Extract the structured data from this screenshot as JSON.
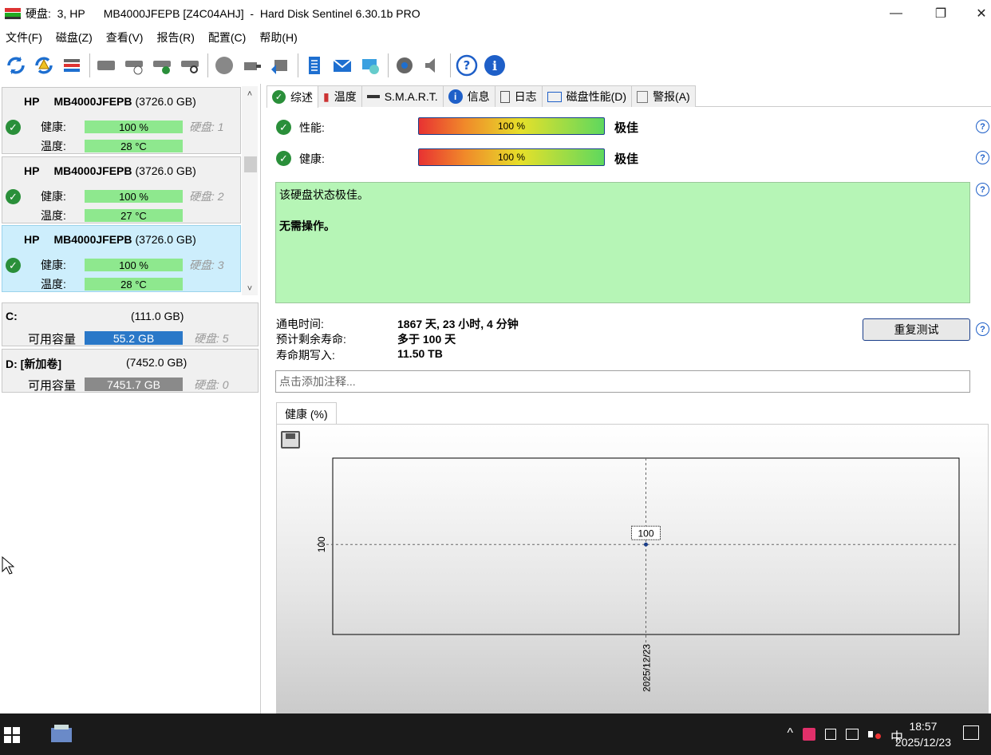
{
  "window": {
    "title": "硬盘:  3, HP      MB4000JFEPB [Z4C04AHJ]  -  Hard Disk Sentinel 6.30.1b PRO",
    "minimize": "—",
    "restore": "❐",
    "close": "✕"
  },
  "menu": [
    "文件(F)",
    "磁盘(Z)",
    "查看(V)",
    "报告(R)",
    "配置(C)",
    "帮助(H)"
  ],
  "toolbar_icons": [
    "refresh-icon",
    "refresh-warning-icon",
    "disk-list-icon",
    "disk-icon",
    "disk-timer-icon",
    "disk-check-icon",
    "disk-search-icon",
    "disk-gray-icon",
    "disk-connect-icon",
    "disk-arrow-icon",
    "report-icon",
    "mail-icon",
    "network-icon",
    "settings-icon",
    "sound-icon",
    "help-icon",
    "info-icon"
  ],
  "disks": [
    {
      "vendor": "HP",
      "model": "MB4000JFEPB",
      "size": "(3726.0 GB)",
      "health_label": "健康:",
      "health": "100 %",
      "temp_label": "温度:",
      "temp": "28 °C",
      "disk_no": "硬盘:  1"
    },
    {
      "vendor": "HP",
      "model": "MB4000JFEPB",
      "size": "(3726.0 GB)",
      "health_label": "健康:",
      "health": "100 %",
      "temp_label": "温度:",
      "temp": "27 °C",
      "disk_no": "硬盘:  2"
    },
    {
      "vendor": "HP",
      "model": "MB4000JFEPB",
      "size": "(3726.0 GB)",
      "health_label": "健康:",
      "health": "100 %",
      "temp_label": "温度:",
      "temp": "28 °C",
      "disk_no": "硬盘:  3"
    }
  ],
  "volumes": [
    {
      "label": "C:",
      "size": "(111.0 GB)",
      "free_label": "可用容量",
      "free": "55.2 GB",
      "free_fraction": 0.5,
      "disk_no": "硬盘:  5",
      "color": "#2a78c8"
    },
    {
      "label": "D: [新加卷]",
      "size": "(7452.0 GB)",
      "free_label": "可用容量",
      "free": "7451.7 GB",
      "free_fraction": 1.0,
      "disk_no": "硬盘:  0",
      "color": "#8a8a8a"
    }
  ],
  "tabs": [
    "综述",
    "温度",
    "S.M.A.R.T.",
    "信息",
    "日志",
    "磁盘性能(D)",
    "警报(A)"
  ],
  "summary": {
    "performance_label": "性能:",
    "performance_value": "100 %",
    "performance_grade": "极佳",
    "health_label": "健康:",
    "health_value": "100 %",
    "health_grade": "极佳",
    "status_line1": "该硬盘状态极佳。",
    "status_line2": "无需操作。",
    "power_on_label": "通电时间:",
    "power_on_value": "1867 天, 23 小时, 4 分钟",
    "remaining_label": "预计剩余寿命:",
    "remaining_value": "多于 100 天",
    "written_label": "寿命期写入:",
    "written_value": "11.50 TB",
    "retest_button": "重复测试",
    "note_placeholder": "点击添加注释..."
  },
  "chart_data": {
    "type": "line",
    "tab_label": "健康 (%)",
    "x": [
      "2025/12/23"
    ],
    "series": [
      {
        "values": [
          100
        ]
      }
    ],
    "point_label": "100",
    "ytick": "100"
  },
  "taskbar": {
    "tray": [
      "^",
      "中"
    ],
    "time": "18:57",
    "date": "2025/12/23"
  },
  "colors": {
    "accent": "#1e5fc8",
    "ok": "#2a8f3a",
    "status_bg": "#b6f5b6"
  }
}
